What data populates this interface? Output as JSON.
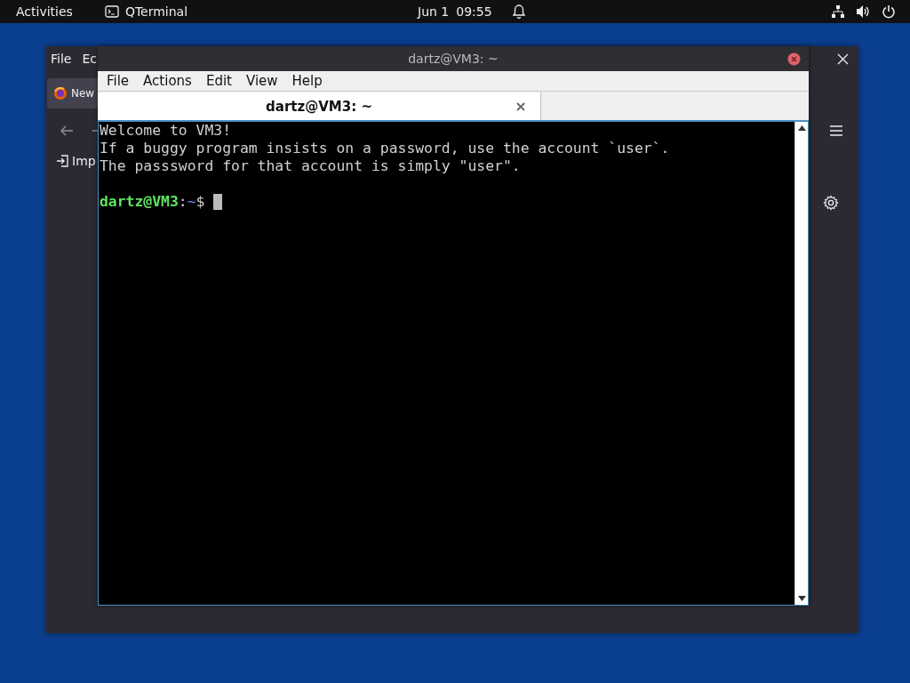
{
  "top_bar": {
    "activities": "Activities",
    "app_name": "QTerminal",
    "date": "Jun 1",
    "time": "09:55"
  },
  "background_window": {
    "menu": [
      "File",
      "Ec"
    ],
    "tab": "New",
    "toolbar_item": "Imp"
  },
  "terminal": {
    "title": "dartz@VM3: ~",
    "menu": [
      "File",
      "Actions",
      "Edit",
      "View",
      "Help"
    ],
    "tabs": [
      {
        "label": "dartz@VM3: ~",
        "selected": true
      }
    ],
    "lines": [
      "Welcome to VM3!",
      "If a buggy program insists on a password, use the account `user`.",
      "The passsword for that account is simply \"user\"."
    ],
    "prompt": {
      "user_host": "dartz@VM3",
      "separator": ":",
      "path": "~",
      "symbol": "$"
    }
  }
}
